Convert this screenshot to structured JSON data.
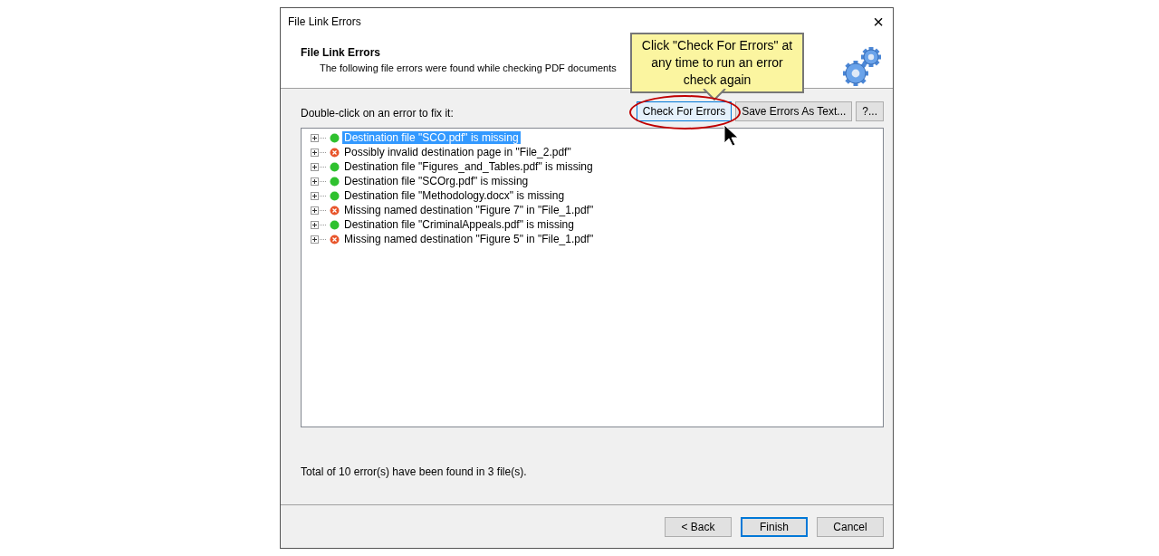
{
  "window": {
    "title": "File Link Errors",
    "close": "×"
  },
  "header": {
    "title": "File Link Errors",
    "subtitle": "The following file errors were found while checking PDF documents"
  },
  "callout": {
    "text": "Click \"Check For Errors\" at any time to run an error check again"
  },
  "instruction": "Double-click on an error to fix it:",
  "toolbar": [
    {
      "label": "Check For Errors",
      "highlighted": true
    },
    {
      "label": "Save Errors As Text...",
      "highlighted": false
    },
    {
      "label": "?...",
      "highlighted": false
    }
  ],
  "errors": [
    {
      "text": "Destination file \"SCO.pdf\" is missing",
      "kind": "missing",
      "selected": true
    },
    {
      "text": "Possibly invalid destination page in \"File_2.pdf\"",
      "kind": "invalid",
      "selected": false
    },
    {
      "text": "Destination file \"Figures_and_Tables.pdf\" is missing",
      "kind": "missing",
      "selected": false
    },
    {
      "text": "Destination file \"SCOrg.pdf\" is missing",
      "kind": "missing",
      "selected": false
    },
    {
      "text": "Destination file \"Methodology.docx\" is missing",
      "kind": "missing",
      "selected": false
    },
    {
      "text": "Missing named destination \"Figure 7\" in \"File_1.pdf\"",
      "kind": "invalid",
      "selected": false
    },
    {
      "text": "Destination file \"CriminalAppeals.pdf\" is missing",
      "kind": "missing",
      "selected": false
    },
    {
      "text": "Missing named destination \"Figure 5\" in \"File_1.pdf\"",
      "kind": "invalid",
      "selected": false
    }
  ],
  "summary": "Total of 10 error(s) have been found in 3 file(s).",
  "buttons": [
    {
      "label": "< Back",
      "default": false
    },
    {
      "label": "Finish",
      "default": true
    },
    {
      "label": "Cancel",
      "default": false
    }
  ]
}
